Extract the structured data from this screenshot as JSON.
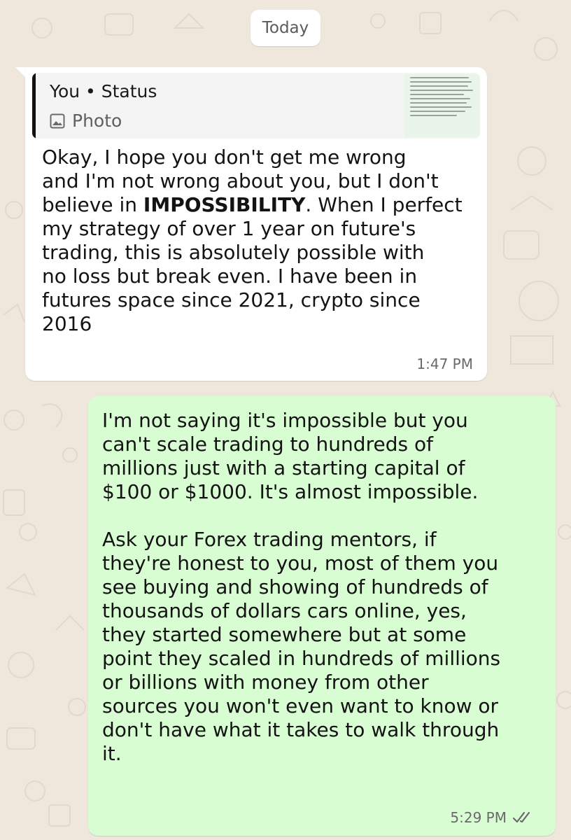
{
  "date_divider": "Today",
  "incoming": {
    "quote": {
      "author": "You • Status",
      "type_label": "Photo",
      "thumbnail_text": [
        "Can you be my mentor, I have $1k,",
        "to make $500 million in 2026, you c",
        "even come and live in my house, fre",
        "food, car to drive to anywhere you w",
        "free light, free clothing, everything",
        "free for the next 365 days provided",
        "can turn my $1k to 500million sinc",
        "you people do magic and ritual in th",
        "country, I wonder which baba use to",
        "you people this kind of kola"
      ]
    },
    "lines": [
      "Okay, I hope you don't get me wrong",
      "and I'm not wrong about you, but I don't",
      "believe in ",
      "IMPOSSIBILITY",
      ". When I perfect",
      "my strategy of over 1 year on future's",
      "trading, this is absolutely possible with",
      "no loss but break even. I have been in",
      "futures space since 2021, crypto since",
      "2016"
    ],
    "time": "1:47 PM"
  },
  "outgoing": {
    "lines": [
      "I'm not saying it's impossible but you",
      "can't scale trading to hundreds of",
      "millions just with a starting capital of",
      "$100 or $1000. It's almost impossible.",
      "",
      "Ask your Forex trading mentors, if",
      "they're honest to you, most of them you",
      "see buying and showing of hundreds of",
      "thousands of dollars cars online, yes,",
      "they started somewhere but at some",
      "point they scaled in hundreds of millions",
      "or billions with money from other",
      "sources you won't even want to know or",
      "don't have what it takes to walk through",
      "it."
    ],
    "time": "5:29 PM",
    "status_icon": "double-check-icon"
  },
  "colors": {
    "background": "#efe7dc",
    "incoming_bubble": "#ffffff",
    "outgoing_bubble": "#d9fdd3",
    "meta_text": "#6a6a6a"
  }
}
